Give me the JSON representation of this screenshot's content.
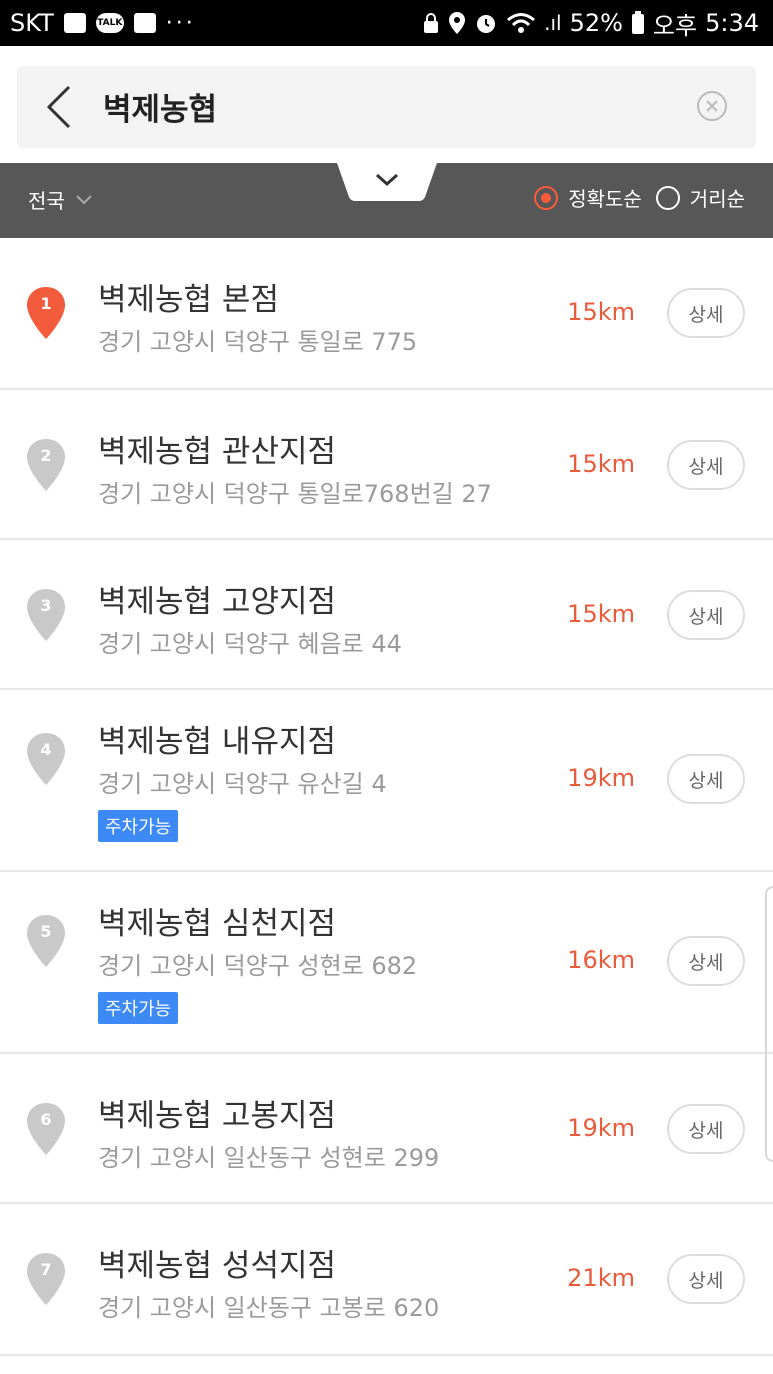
{
  "status_bar": {
    "carrier": "SKT",
    "talk_label": "TALK",
    "more": "···",
    "signal": ".ıl",
    "battery": "52%",
    "ampm": "오후",
    "time": "5:34"
  },
  "search": {
    "query": "벽제농협"
  },
  "filter": {
    "region": "전국",
    "sort_options": [
      {
        "label": "정확도순",
        "selected": true
      },
      {
        "label": "거리순",
        "selected": false
      }
    ]
  },
  "colors": {
    "accent": "#ff5a3c",
    "distance": "#e85c3c",
    "badge": "#3d8af7",
    "pin_active": "#f25c3c",
    "pin_inactive": "#c9c9c9"
  },
  "results": [
    {
      "num": "1",
      "name": "벽제농협 본점",
      "address": "경기 고양시 덕양구 통일로 775",
      "distance": "15km",
      "detail": "상세",
      "badge": ""
    },
    {
      "num": "2",
      "name": "벽제농협 관산지점",
      "address": "경기 고양시 덕양구 통일로768번길 27",
      "distance": "15km",
      "detail": "상세",
      "badge": ""
    },
    {
      "num": "3",
      "name": "벽제농협 고양지점",
      "address": "경기 고양시 덕양구 혜음로 44",
      "distance": "15km",
      "detail": "상세",
      "badge": ""
    },
    {
      "num": "4",
      "name": "벽제농협 내유지점",
      "address": "경기 고양시 덕양구 유산길 4",
      "distance": "19km",
      "detail": "상세",
      "badge": "주차가능"
    },
    {
      "num": "5",
      "name": "벽제농협 심천지점",
      "address": "경기 고양시 덕양구 성현로 682",
      "distance": "16km",
      "detail": "상세",
      "badge": "주차가능"
    },
    {
      "num": "6",
      "name": "벽제농협 고봉지점",
      "address": "경기 고양시 일산동구 성현로 299",
      "distance": "19km",
      "detail": "상세",
      "badge": ""
    },
    {
      "num": "7",
      "name": "벽제농협 성석지점",
      "address": "경기 고양시 일산동구 고봉로 620",
      "distance": "21km",
      "detail": "상세",
      "badge": ""
    }
  ]
}
